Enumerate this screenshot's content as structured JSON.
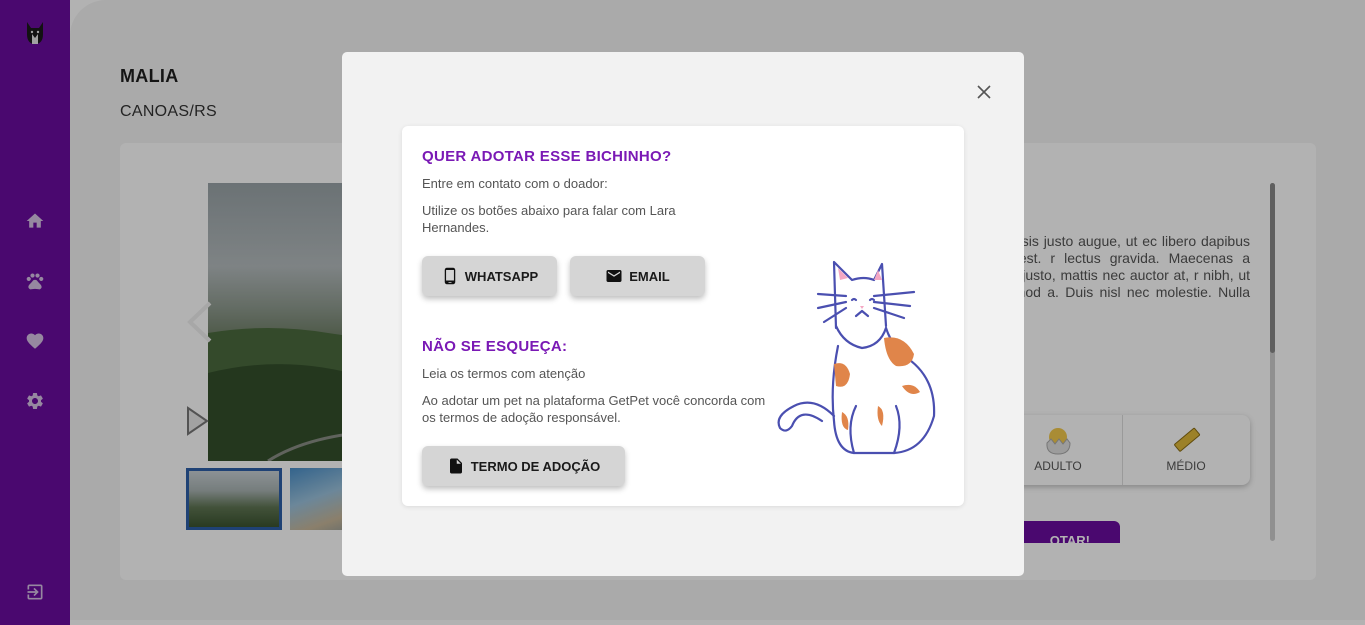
{
  "sidebar": {
    "logo": "cat-logo-icon",
    "items": [
      {
        "icon": "home-icon"
      },
      {
        "icon": "paw-icon"
      },
      {
        "icon": "heart-icon"
      },
      {
        "icon": "gear-icon"
      }
    ],
    "logout_icon": "logout-icon",
    "color": "#6a0ca0"
  },
  "pet": {
    "name": "MALIA",
    "location": "CANOAS/RS",
    "description": "iscing elit. In facilisis justo augue, ut ec libero dapibus ultricies et sed est. r lectus gravida. Maecenas a tempor usce velit justo, mattis nec auctor at, r nibh, ut varius urna euismod a. Duis nisl nec molestie. Nulla imperdiet",
    "attributes": [
      {
        "icon": "chick-icon",
        "label": "ADULTO"
      },
      {
        "icon": "ruler-icon",
        "label": "MÉDIO"
      }
    ],
    "adopt_button_label": "OTAR!"
  },
  "modal": {
    "close_icon": "close-icon",
    "adopt_title": "QUER ADOTAR ESSE BICHINHO?",
    "contact_intro": "Entre em contato com o doador:",
    "contact_instructions": "Utilize os botões abaixo para falar com Lara Hernandes.",
    "whatsapp_label": "WHATSAPP",
    "email_label": "EMAIL",
    "reminder_title": "NÃO SE ESQUEÇA:",
    "terms_intro": "Leia os termos com atenção",
    "terms_text": "Ao adotar um pet na plataforma GetPet você concorda com os termos de adoção responsável.",
    "terms_button_label": "TERMO DE ADOÇÃO",
    "accent_color": "#7a19b5"
  }
}
